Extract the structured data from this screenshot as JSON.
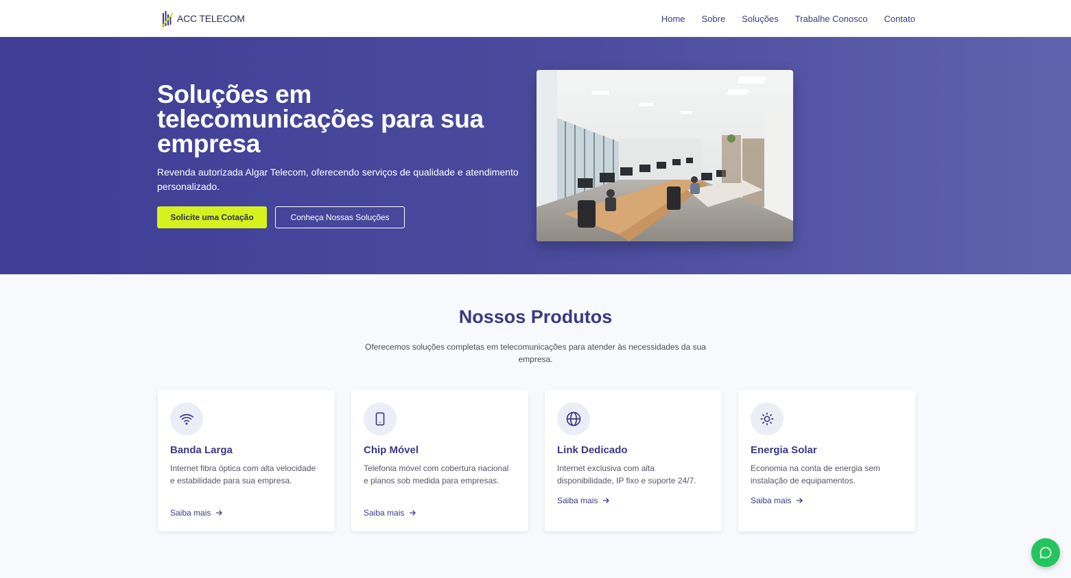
{
  "brand": {
    "name": "ACC TELECOM",
    "accent": "#d6f21e",
    "primary": "#3f3d96"
  },
  "nav": {
    "items": [
      {
        "label": "Home"
      },
      {
        "label": "Sobre"
      },
      {
        "label": "Soluções"
      },
      {
        "label": "Trabalhe Conosco"
      },
      {
        "label": "Contato"
      }
    ]
  },
  "hero": {
    "title": "Soluções em telecomunicações para sua empresa",
    "subtitle": "Revenda autorizada Algar Telecom, oferecendo serviços de qualidade e atendimento personalizado.",
    "primary_button": "Solicite uma Cotação",
    "secondary_button": "Conheça Nossas Soluções",
    "image_icon": "office-photo"
  },
  "products": {
    "title": "Nossos Produtos",
    "description": "Oferecemos soluções completas em telecomunicações para atender às necessidades da sua empresa.",
    "cards": [
      {
        "icon": "wifi-icon",
        "title": "Banda Larga",
        "description": "Internet fibra óptica com alta velocidade e estabilidade para sua empresa.",
        "link": "Saiba mais"
      },
      {
        "icon": "smartphone-icon",
        "title": "Chip Móvel",
        "description": "Telefonia móvel com cobertura nacional e planos sob medida para empresas.",
        "link": "Saiba mais"
      },
      {
        "icon": "globe-icon",
        "title": "Link Dedicado",
        "description": "Internet exclusiva com alta disponibilidade, IP fixo e suporte 24/7.",
        "link": "Saiba mais"
      },
      {
        "icon": "sun-icon",
        "title": "Energia Solar",
        "description": "Economia na conta de energia sem instalação de equipamentos.",
        "link": "Saiba mais"
      }
    ]
  },
  "chat": {
    "icon": "chat-bubble-icon",
    "color": "#22c55e"
  }
}
